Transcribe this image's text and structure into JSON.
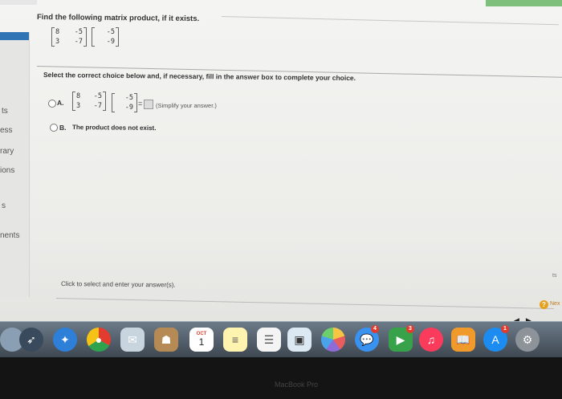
{
  "question": {
    "title": "Find the following matrix product, if it exists.",
    "matrix_a": [
      [
        "8",
        "-5"
      ],
      [
        "3",
        "-7"
      ]
    ],
    "matrix_b": [
      [
        "-5"
      ],
      [
        "-9"
      ]
    ]
  },
  "instruction": "Select the correct choice below and, if necessary, fill in the answer box to complete your choice.",
  "options": {
    "a": {
      "letter": "A.",
      "equals": "=",
      "answer_value": "",
      "hint": "(Simplify your answer.)"
    },
    "b": {
      "letter": "B.",
      "text": "The product does not exist."
    }
  },
  "footer": {
    "click_text": "Click to select and enter your answer(s).",
    "help_symbol": "?",
    "next_label": "Nex",
    "right_edge": "ts",
    "arrows": [
      "◀",
      "▶"
    ]
  },
  "sidebar": {
    "items": [
      "ts",
      "ess",
      "rary",
      "ions",
      "s",
      "nents"
    ]
  },
  "dock": {
    "calendar_month": "OCT",
    "calendar_day": "1",
    "badges": {
      "messages": "4",
      "facetime": "3",
      "appstore": "1"
    }
  },
  "bezel": "MacBook Pro",
  "colors": {
    "accent": "#2f75b5",
    "help": "#e6a21f",
    "dock": "#4a5561"
  }
}
